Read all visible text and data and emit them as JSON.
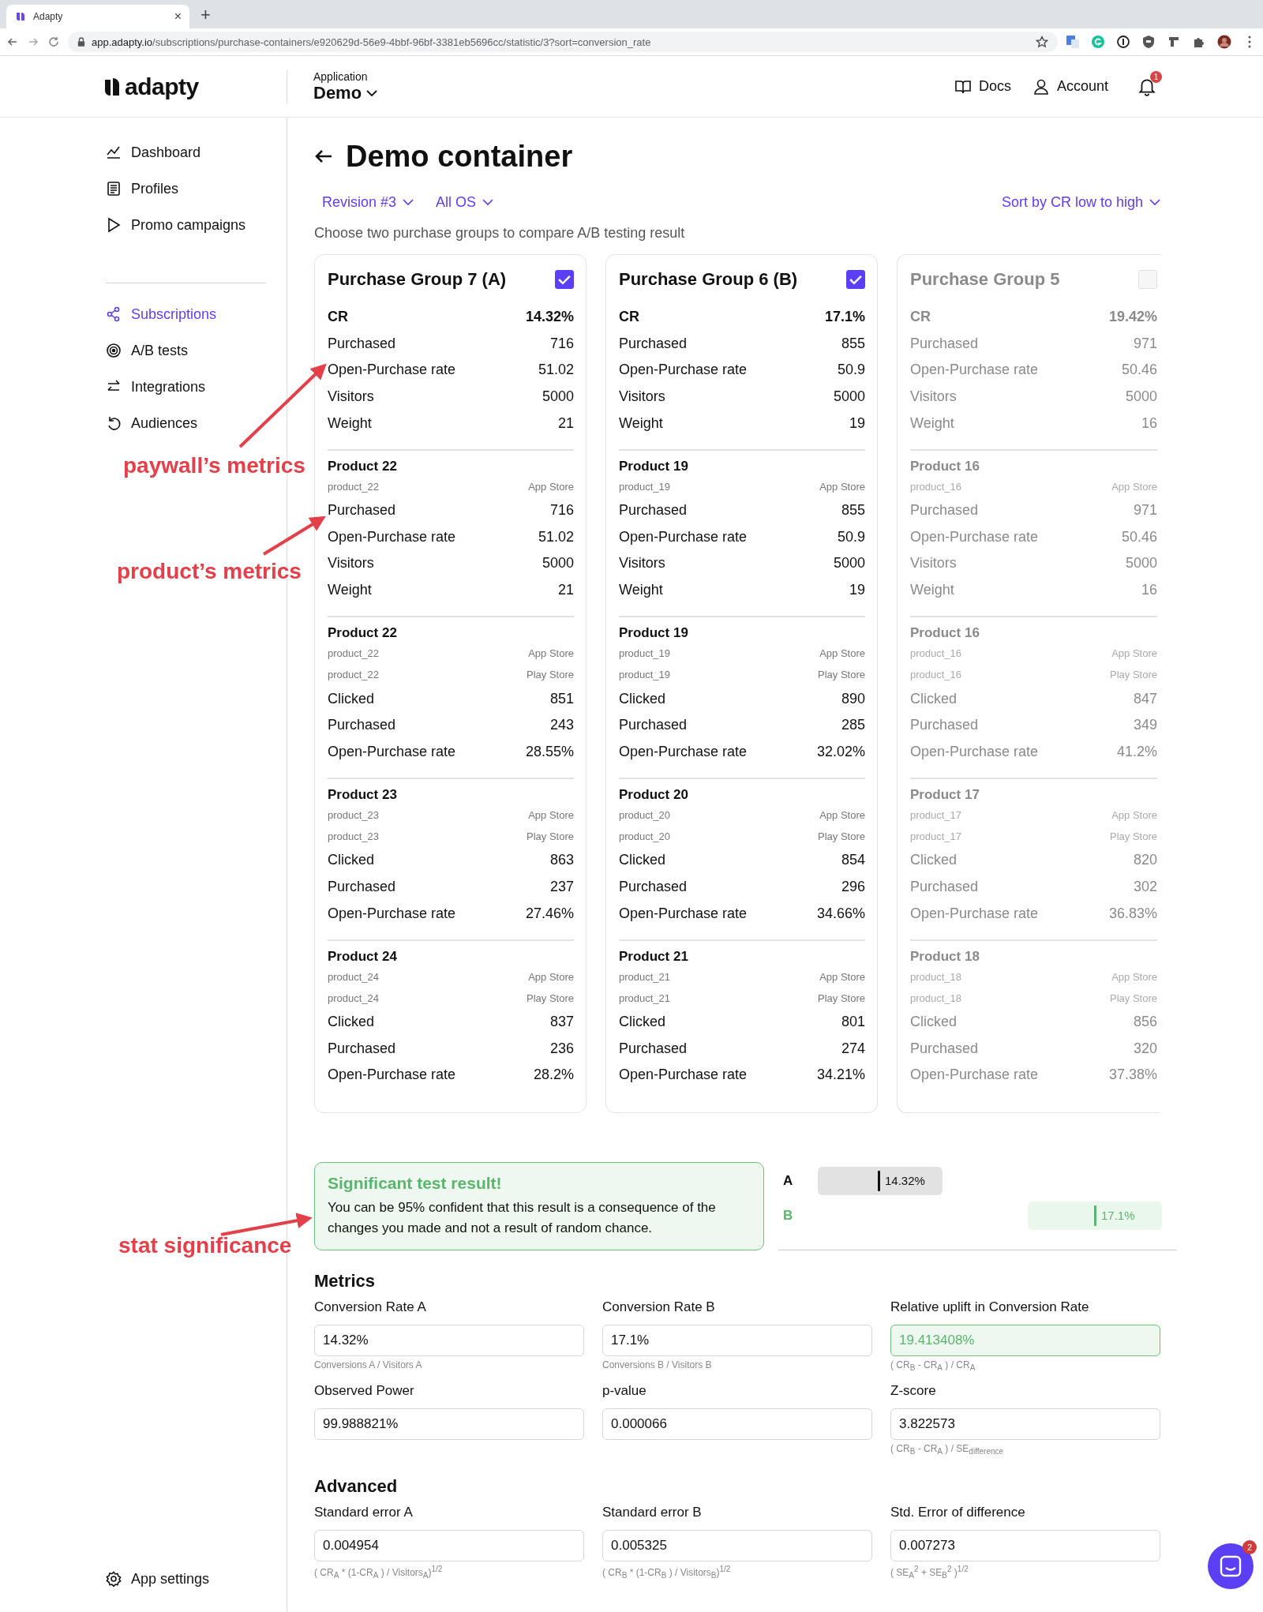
{
  "browser": {
    "tab_title": "Adapty",
    "tab_close": "×",
    "new_tab": "+",
    "url": {
      "host": "app.adapty.io",
      "path": "/subscriptions/purchase-containers/e920629d-56e9-4bbf-96bf-3381eb5696cc/statistic/3?sort=conversion_rate"
    }
  },
  "header": {
    "logo": "adapty",
    "app_label": "Application",
    "app_name": "Demo",
    "links": [
      {
        "kind": "docs",
        "label": "Docs"
      },
      {
        "kind": "account",
        "label": "Account"
      }
    ],
    "notifications": "1"
  },
  "sidebar": {
    "groups": [
      [
        {
          "kind": "dashboard",
          "label": "Dashboard",
          "selected": false
        },
        {
          "kind": "profiles",
          "label": "Profiles",
          "selected": false
        },
        {
          "kind": "promo",
          "label": "Promo campaigns",
          "selected": false
        }
      ],
      [
        {
          "kind": "subscriptions",
          "label": "Subscriptions",
          "selected": true
        },
        {
          "kind": "abtests",
          "label": "A/B tests",
          "selected": false
        },
        {
          "kind": "integrations",
          "label": "Integrations",
          "selected": false
        },
        {
          "kind": "audiences",
          "label": "Audiences",
          "selected": false
        }
      ]
    ],
    "footer": {
      "kind": "settings",
      "label": "App settings",
      "selected": false
    }
  },
  "page": {
    "title": "Demo container",
    "filters": [
      "Revision #3",
      "All OS"
    ],
    "sort": "Sort by CR low to high",
    "hint": "Choose two purchase groups to compare A/B testing result"
  },
  "groups": [
    {
      "title": "Purchase Group 7 (A)",
      "selected": true,
      "cr_label": "CR",
      "cr": "14.32%",
      "metrics": [
        {
          "label": "Purchased",
          "value": "716"
        },
        {
          "label": "Open-Purchase rate",
          "value": "51.02"
        },
        {
          "label": "Visitors",
          "value": "5000"
        },
        {
          "label": "Weight",
          "value": "21"
        }
      ],
      "products": [
        {
          "name": "Product 22",
          "ids": [
            {
              "id": "product_22",
              "store": "App Store"
            }
          ],
          "metrics": [
            {
              "label": "Purchased",
              "value": "716"
            },
            {
              "label": "Open-Purchase rate",
              "value": "51.02"
            },
            {
              "label": "Visitors",
              "value": "5000"
            },
            {
              "label": "Weight",
              "value": "21"
            }
          ]
        },
        {
          "name": "Product 22",
          "ids": [
            {
              "id": "product_22",
              "store": "App Store"
            },
            {
              "id": "product_22",
              "store": "Play Store"
            }
          ],
          "metrics": [
            {
              "label": "Clicked",
              "value": "851"
            },
            {
              "label": "Purchased",
              "value": "243"
            },
            {
              "label": "Open-Purchase rate",
              "value": "28.55%"
            }
          ]
        },
        {
          "name": "Product 23",
          "ids": [
            {
              "id": "product_23",
              "store": "App Store"
            },
            {
              "id": "product_23",
              "store": "Play Store"
            }
          ],
          "metrics": [
            {
              "label": "Clicked",
              "value": "863"
            },
            {
              "label": "Purchased",
              "value": "237"
            },
            {
              "label": "Open-Purchase rate",
              "value": "27.46%"
            }
          ]
        },
        {
          "name": "Product 24",
          "ids": [
            {
              "id": "product_24",
              "store": "App Store"
            },
            {
              "id": "product_24",
              "store": "Play Store"
            }
          ],
          "metrics": [
            {
              "label": "Clicked",
              "value": "837"
            },
            {
              "label": "Purchased",
              "value": "236"
            },
            {
              "label": "Open-Purchase rate",
              "value": "28.2%"
            }
          ]
        }
      ]
    },
    {
      "title": "Purchase Group 6 (B)",
      "selected": true,
      "cr_label": "CR",
      "cr": "17.1%",
      "metrics": [
        {
          "label": "Purchased",
          "value": "855"
        },
        {
          "label": "Open-Purchase rate",
          "value": "50.9"
        },
        {
          "label": "Visitors",
          "value": "5000"
        },
        {
          "label": "Weight",
          "value": "19"
        }
      ],
      "products": [
        {
          "name": "Product 19",
          "ids": [
            {
              "id": "product_19",
              "store": "App Store"
            }
          ],
          "metrics": [
            {
              "label": "Purchased",
              "value": "855"
            },
            {
              "label": "Open-Purchase rate",
              "value": "50.9"
            },
            {
              "label": "Visitors",
              "value": "5000"
            },
            {
              "label": "Weight",
              "value": "19"
            }
          ]
        },
        {
          "name": "Product 19",
          "ids": [
            {
              "id": "product_19",
              "store": "App Store"
            },
            {
              "id": "product_19",
              "store": "Play Store"
            }
          ],
          "metrics": [
            {
              "label": "Clicked",
              "value": "890"
            },
            {
              "label": "Purchased",
              "value": "285"
            },
            {
              "label": "Open-Purchase rate",
              "value": "32.02%"
            }
          ]
        },
        {
          "name": "Product 20",
          "ids": [
            {
              "id": "product_20",
              "store": "App Store"
            },
            {
              "id": "product_20",
              "store": "Play Store"
            }
          ],
          "metrics": [
            {
              "label": "Clicked",
              "value": "854"
            },
            {
              "label": "Purchased",
              "value": "296"
            },
            {
              "label": "Open-Purchase rate",
              "value": "34.66%"
            }
          ]
        },
        {
          "name": "Product 21",
          "ids": [
            {
              "id": "product_21",
              "store": "App Store"
            },
            {
              "id": "product_21",
              "store": "Play Store"
            }
          ],
          "metrics": [
            {
              "label": "Clicked",
              "value": "801"
            },
            {
              "label": "Purchased",
              "value": "274"
            },
            {
              "label": "Open-Purchase rate",
              "value": "34.21%"
            }
          ]
        }
      ]
    },
    {
      "title": "Purchase Group 5",
      "selected": false,
      "cr_label": "CR",
      "cr": "19.42%",
      "metrics": [
        {
          "label": "Purchased",
          "value": "971"
        },
        {
          "label": "Open-Purchase rate",
          "value": "50.46"
        },
        {
          "label": "Visitors",
          "value": "5000"
        },
        {
          "label": "Weight",
          "value": "16"
        }
      ],
      "products": [
        {
          "name": "Product 16",
          "ids": [
            {
              "id": "product_16",
              "store": "App Store"
            }
          ],
          "metrics": [
            {
              "label": "Purchased",
              "value": "971"
            },
            {
              "label": "Open-Purchase rate",
              "value": "50.46"
            },
            {
              "label": "Visitors",
              "value": "5000"
            },
            {
              "label": "Weight",
              "value": "16"
            }
          ]
        },
        {
          "name": "Product 16",
          "ids": [
            {
              "id": "product_16",
              "store": "App Store"
            },
            {
              "id": "product_16",
              "store": "Play Store"
            }
          ],
          "metrics": [
            {
              "label": "Clicked",
              "value": "847"
            },
            {
              "label": "Purchased",
              "value": "349"
            },
            {
              "label": "Open-Purchase rate",
              "value": "41.2%"
            }
          ]
        },
        {
          "name": "Product 17",
          "ids": [
            {
              "id": "product_17",
              "store": "App Store"
            },
            {
              "id": "product_17",
              "store": "Play Store"
            }
          ],
          "metrics": [
            {
              "label": "Clicked",
              "value": "820"
            },
            {
              "label": "Purchased",
              "value": "302"
            },
            {
              "label": "Open-Purchase rate",
              "value": "36.83%"
            }
          ]
        },
        {
          "name": "Product 18",
          "ids": [
            {
              "id": "product_18",
              "store": "App Store"
            },
            {
              "id": "product_18",
              "store": "Play Store"
            }
          ],
          "metrics": [
            {
              "label": "Clicked",
              "value": "856"
            },
            {
              "label": "Purchased",
              "value": "320"
            },
            {
              "label": "Open-Purchase rate",
              "value": "37.38%"
            }
          ]
        }
      ]
    }
  ],
  "result": {
    "title": "Significant test result!",
    "text": "You can be 95% confident that this result is a consequence of the changes you made and not a result of random chance."
  },
  "bars": [
    {
      "label": "A",
      "value": "14.32%",
      "kind": "control"
    },
    {
      "label": "B",
      "value": "17.1%",
      "kind": "winner"
    }
  ],
  "sections": [
    {
      "title": "Metrics",
      "fields": [
        {
          "label": "Conversion Rate A",
          "value": "14.32%",
          "hint": "Conversions A / Visitors A",
          "kind": "plain"
        },
        {
          "label": "Conversion Rate B",
          "value": "17.1%",
          "hint": "Conversions B / Visitors B",
          "kind": "plain"
        },
        {
          "label": "Relative uplift in Conversion Rate",
          "value": "19.413408%",
          "hint": "( CR$_{B}$ - CR$_{A}$ ) / CR$_{A}$",
          "kind": "positive"
        },
        {
          "label": "Observed Power",
          "value": "99.988821%",
          "kind": "plain"
        },
        {
          "label": "p-value",
          "value": "0.000066",
          "kind": "plain"
        },
        {
          "label": "Z-score",
          "value": "3.822573",
          "hint": "( CR$_{B}$ - CR$_{A}$ ) / SE$_{difference}$",
          "kind": "plain"
        }
      ]
    },
    {
      "title": "Advanced",
      "fields": [
        {
          "label": "Standard error A",
          "value": "0.004954",
          "hint": "( CR$_{A}$ * (1-CR$_{A}$ ) / Visitors$_{A}$)$^{1/2}$",
          "kind": "plain"
        },
        {
          "label": "Standard error B",
          "value": "0.005325",
          "hint": "( CR$_{B}$ * (1-CR$_{B}$ ) / Visitors$_{B}$)$^{1/2}$",
          "kind": "plain"
        },
        {
          "label": "Std. Error of difference",
          "value": "0.007273",
          "hint": "( SE$_{A}$$^{2}$ + SE$_{B}$$^{2}$ )$^{1/2}$",
          "kind": "plain"
        }
      ]
    }
  ],
  "chat_badge": "2",
  "annotations": [
    {
      "kind": "paywall",
      "text": "paywall’s metrics"
    },
    {
      "kind": "product",
      "text": "product’s metrics"
    },
    {
      "kind": "significance",
      "text": "stat significance"
    }
  ]
}
